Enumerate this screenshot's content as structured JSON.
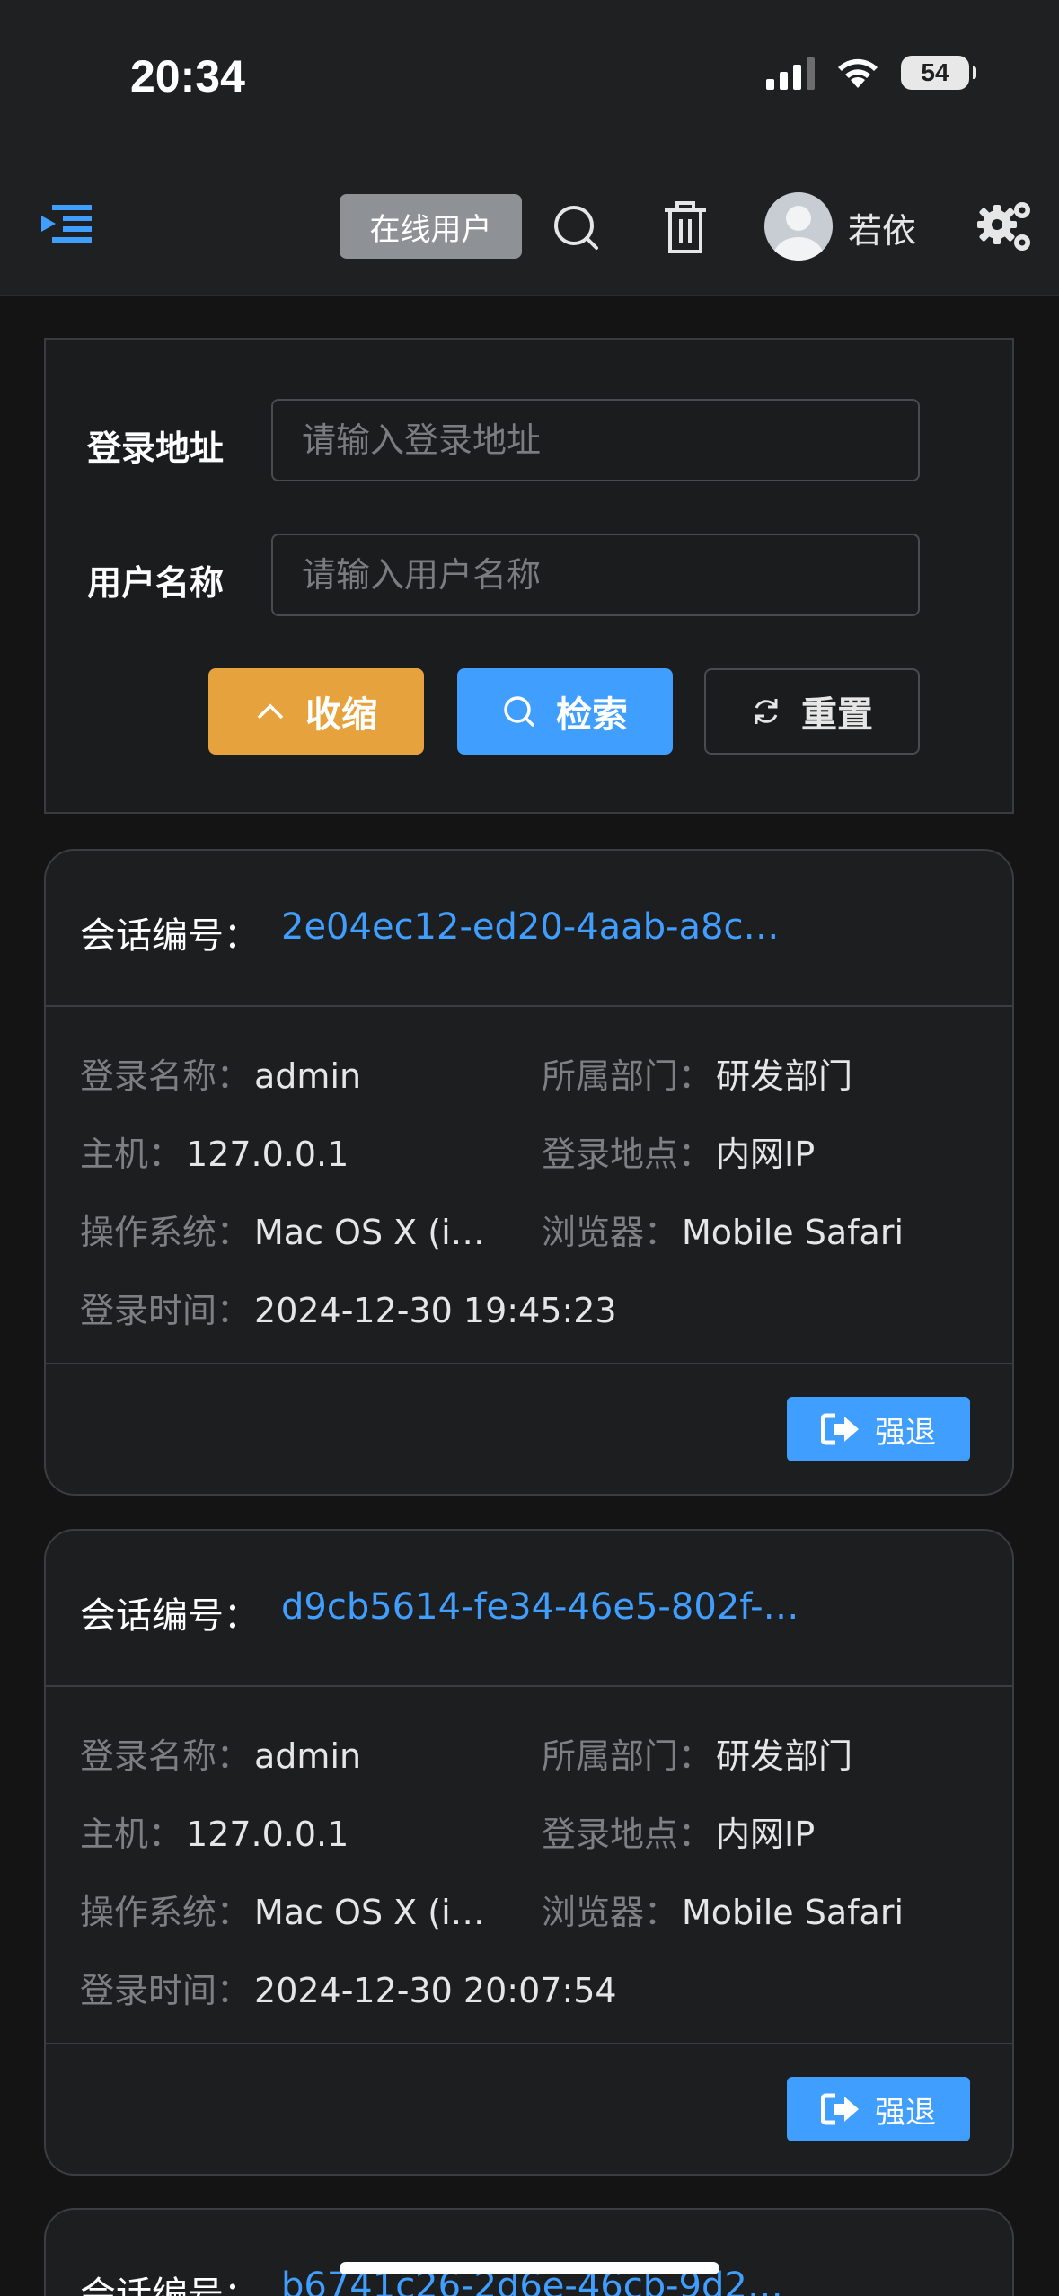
{
  "status": {
    "time": "20:34",
    "battery": "54"
  },
  "header": {
    "online_tag": "在线用户",
    "username": "若依"
  },
  "search_form": {
    "ipaddr_label": "登录地址",
    "ipaddr_placeholder": "请输入登录地址",
    "username_label": "用户名称",
    "username_placeholder": "请输入用户名称",
    "collapse_label": "收缩",
    "search_label": "检索",
    "reset_label": "重置"
  },
  "labels": {
    "session_id": "会话编号：",
    "login_name": "登录名称：",
    "dept": "所属部门：",
    "host": "主机：",
    "location": "登录地点：",
    "os": "操作系统：",
    "browser": "浏览器：",
    "login_time": "登录时间：",
    "force_logout": "强退"
  },
  "sessions": [
    {
      "id": "2e04ec12-ed20-4aab-a8c…",
      "login_name": "admin",
      "dept": "研发部门",
      "host": "127.0.0.1",
      "location": "内网IP",
      "os": "Mac OS X (i…",
      "browser": "Mobile Safari",
      "login_time": "2024-12-30 19:45:23"
    },
    {
      "id": "d9cb5614-fe34-46e5-802f-…",
      "login_name": "admin",
      "dept": "研发部门",
      "host": "127.0.0.1",
      "location": "内网IP",
      "os": "Mac OS X (i…",
      "browser": "Mobile Safari",
      "login_time": "2024-12-30 20:07:54"
    },
    {
      "id": "b6741c26-2d6e-46cb-9d2…"
    }
  ]
}
